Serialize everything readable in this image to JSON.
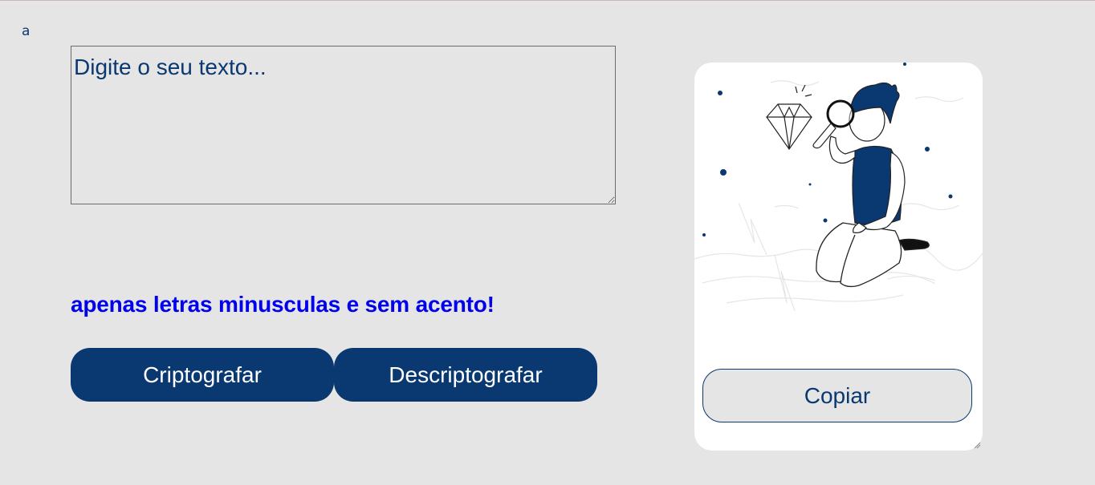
{
  "logo": {
    "text": "a"
  },
  "input": {
    "placeholder": "Digite o seu texto...",
    "value": ""
  },
  "warning": {
    "text": "apenas letras minusculas e sem acento!"
  },
  "buttons": {
    "encrypt_label": "Criptografar",
    "decrypt_label": "Descriptografar",
    "copy_label": "Copiar"
  },
  "colors": {
    "background": "#e5e5e5",
    "primary": "#0a3871",
    "warning": "#0000ee",
    "card": "#ffffff"
  },
  "illustration": {
    "icon": "person-with-magnifier-diamond-illustration"
  }
}
